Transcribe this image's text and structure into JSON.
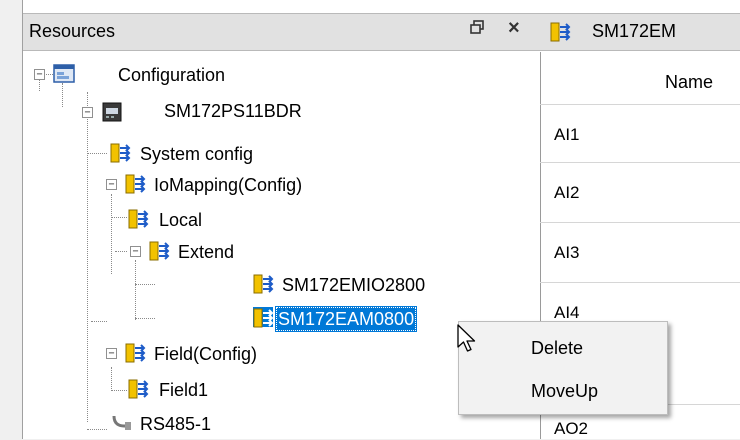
{
  "resources_panel": {
    "title": "Resources",
    "float_icon": "restore-window-icon",
    "close_icon": "close-icon",
    "close_glyph": "×"
  },
  "tree": {
    "nodes": [
      {
        "label": "Configuration",
        "icon": "configuration-icon",
        "expanded": true
      },
      {
        "label": "SM172PS11BDR",
        "icon": "device-icon",
        "expanded": true
      },
      {
        "label": "System config",
        "icon": "mapping-icon"
      },
      {
        "label": "IoMapping(Config)",
        "icon": "mapping-icon",
        "expanded": true
      },
      {
        "label": "Local",
        "icon": "mapping-icon"
      },
      {
        "label": "Extend",
        "icon": "mapping-icon",
        "expanded": true
      },
      {
        "label": "SM172EMIO2800",
        "icon": "mapping-icon"
      },
      {
        "label": "SM172EAM0800",
        "icon": "mapping-icon",
        "selected": true
      },
      {
        "label": "Field(Config)",
        "icon": "mapping-icon",
        "expanded": true
      },
      {
        "label": "Field1",
        "icon": "mapping-icon"
      },
      {
        "label": "RS485-1",
        "icon": "serial-port-icon"
      }
    ]
  },
  "editor": {
    "tab_title": "SM172EM",
    "table": {
      "columns": [
        "Name"
      ],
      "rows": [
        "AI1",
        "AI2",
        "AI3",
        "AI4",
        "AO2"
      ]
    }
  },
  "context_menu": {
    "items": [
      "Delete",
      "MoveUp"
    ]
  },
  "colors": {
    "selection": "#0078d7",
    "panel_header": "#e1e1e1",
    "icon_yellow": "#f2c200",
    "icon_blue": "#1e5cc8"
  }
}
